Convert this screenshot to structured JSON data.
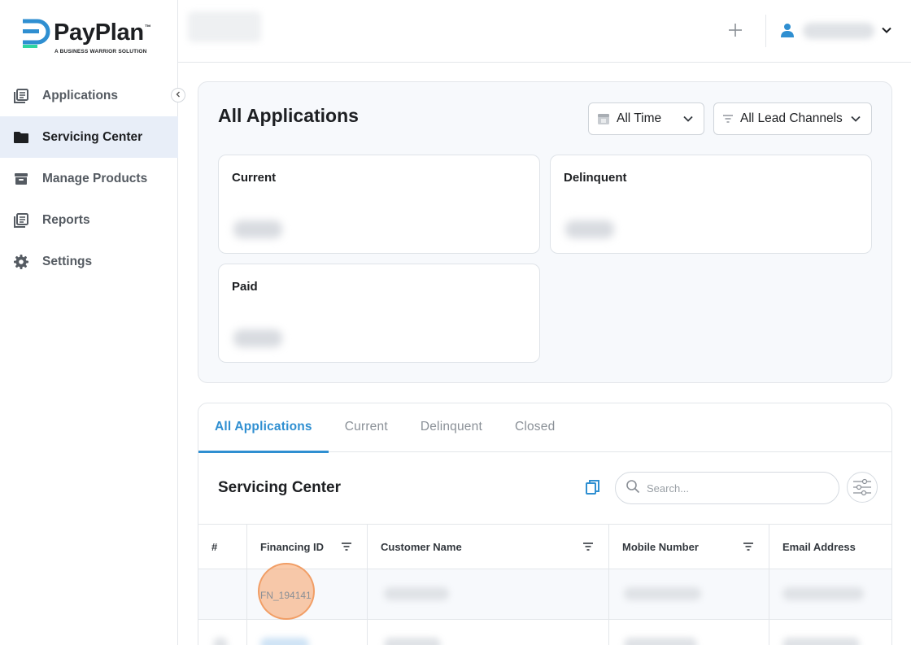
{
  "brand": {
    "name": "PayPlan",
    "trademark": "™",
    "tagline": "A BUSINESS WARRIOR SOLUTION",
    "colors": {
      "mark_blue": "#2f8fd1",
      "mark_green": "#2ed6a0",
      "accent": "#2f8fd1"
    }
  },
  "sidebar": {
    "collapse_icon": "chevron-left-icon",
    "items": [
      {
        "label": "Applications",
        "icon": "document-stack-icon",
        "active": false
      },
      {
        "label": "Servicing Center",
        "icon": "folder-icon",
        "active": true
      },
      {
        "label": "Manage Products",
        "icon": "archive-box-icon",
        "active": false
      },
      {
        "label": "Reports",
        "icon": "document-stack-icon",
        "active": false
      },
      {
        "label": "Settings",
        "icon": "gear-icon",
        "active": false
      }
    ]
  },
  "topbar": {
    "add_icon": "plus-icon",
    "user_icon": "user-icon",
    "menu_icon": "chevron-down-icon"
  },
  "summary": {
    "title": "All Applications",
    "time_filter": {
      "label": "All Time",
      "icon": "calendar-icon"
    },
    "channel_filter": {
      "label": "All Lead Channels",
      "icon": "filter-lines-icon"
    },
    "cards": [
      {
        "title": "Current"
      },
      {
        "title": "Delinquent"
      },
      {
        "title": "Paid"
      }
    ]
  },
  "table_panel": {
    "tabs": [
      {
        "label": "All Applications",
        "active": true
      },
      {
        "label": "Current",
        "active": false
      },
      {
        "label": "Delinquent",
        "active": false
      },
      {
        "label": "Closed",
        "active": false
      }
    ],
    "title": "Servicing Center",
    "search_placeholder": "Search...",
    "columns": [
      "#",
      "Financing ID",
      "Customer Name",
      "Mobile Number",
      "Email Address"
    ],
    "rows": [
      {
        "financing_id": "FN_194141"
      }
    ]
  }
}
